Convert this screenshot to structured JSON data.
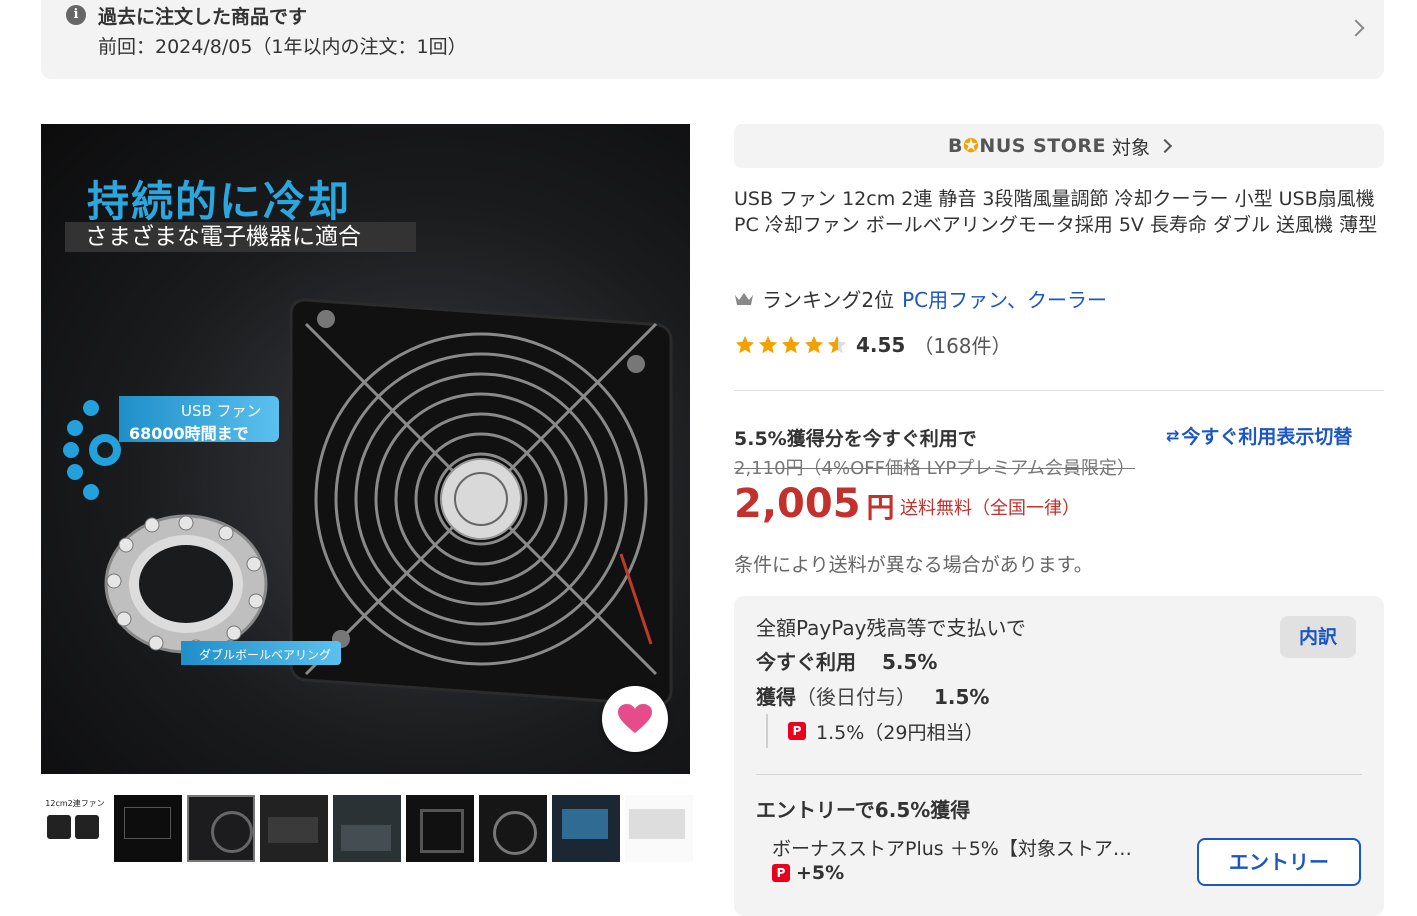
{
  "past_order": {
    "title": "過去に注文した商品です",
    "subtitle": "前回：2024/8/05（1年以内の注文：1回）"
  },
  "main_image": {
    "headline": "持続的に冷却",
    "subhead": "さまざまな電子機器に適合",
    "badge_line1": "USB ファン",
    "badge_line2": "68000時間まで",
    "bearing_label": "ダブルボールベアリング"
  },
  "thumbnails": {
    "count": 9,
    "first_caption": "12cm2連ファン",
    "selected_index": 2
  },
  "bonus_store": {
    "logo_pre": "B",
    "logo_post": "NUS STORE",
    "target": "対象"
  },
  "product": {
    "title": "USB ファン 12cm 2連 静音 3段階風量調節 冷却クーラー 小型 USB扇風機 PC 冷却ファン ボールベアリングモータ採用 5V 長寿命 ダブル 送風機 薄型",
    "ranking_text": "ランキング2位",
    "ranking_category": "PC用ファン、クーラー",
    "rating_value": 4.55,
    "rating_score": "4.55",
    "rating_count": "（168件）"
  },
  "pricing": {
    "use_now_label": "5.5%獲得分を今すぐ利用で",
    "toggle_label": "今すぐ利用表示切替",
    "strike_price": "2,110円（4%OFF価格 LYPプレミアム会員限定）",
    "price_num": "2,005",
    "price_unit": "円",
    "shipping": "送料無料（全国一律）",
    "shipping_note": "条件により送料が異なる場合があります。"
  },
  "payment": {
    "title": "全額PayPay残高等で支払いで",
    "breakdown_button": "内訳",
    "use_now_label": "今すぐ利用",
    "use_now_pct": "5.5%",
    "earn_label": "獲得",
    "earn_note": "（後日付与）",
    "earn_pct": "1.5%",
    "paypay_detail": "1.5%（29円相当）",
    "entry_title": "エントリーで6.5%獲得",
    "entry_item": "ボーナスストアPlus ＋5%【対象ストア…",
    "entry_bonus": "+5%",
    "entry_button": "エントリー"
  },
  "colors": {
    "price_red": "#c4302b",
    "link_blue": "#1a56c4",
    "star_gold": "#f2a100",
    "heart_pink": "#e44c8a"
  }
}
